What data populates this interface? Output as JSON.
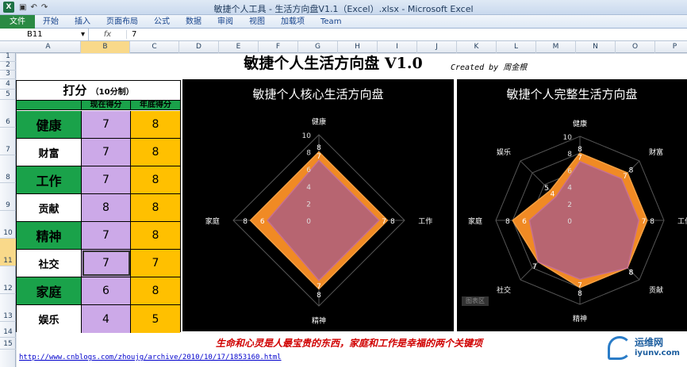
{
  "window": {
    "title": "敏捷个人工具 - 生活方向盘V1.1（Excel）.xlsx - Microsoft Excel",
    "app_icon": "X"
  },
  "ribbon": {
    "tabs": [
      "文件",
      "开始",
      "插入",
      "页面布局",
      "公式",
      "数据",
      "审阅",
      "视图",
      "加载项",
      "Team"
    ]
  },
  "formula_bar": {
    "cell": "B11",
    "fx": "fx",
    "value": "7"
  },
  "columns": [
    "A",
    "B",
    "C",
    "D",
    "E",
    "F",
    "G",
    "H",
    "I",
    "J",
    "K",
    "L",
    "M",
    "N",
    "O",
    "P"
  ],
  "rows": [
    "1",
    "2",
    "3",
    "4",
    "5",
    "6",
    "7",
    "8",
    "9",
    "10",
    "11",
    "12",
    "13",
    "14",
    "15"
  ],
  "sheet": {
    "title": "敏捷个人生活方向盘 V1.0",
    "credit": "Created by 周金根",
    "score_header": "打分",
    "score_header_note": "（10分制）",
    "col_now": "现在得分",
    "col_end": "年底得分",
    "slogan": "生命和心灵是人最宝贵的东西，家庭和工作是幸福的两个关键项",
    "link": "http://www.cnblogs.com/zhoujg/archive/2010/10/17/1853160.html",
    "items": [
      {
        "name": "健康",
        "now": "7",
        "end": "8",
        "style": "green"
      },
      {
        "name": "财富",
        "now": "7",
        "end": "8",
        "style": "white"
      },
      {
        "name": "工作",
        "now": "7",
        "end": "8",
        "style": "green"
      },
      {
        "name": "贡献",
        "now": "8",
        "end": "8",
        "style": "white"
      },
      {
        "name": "精神",
        "now": "7",
        "end": "8",
        "style": "green"
      },
      {
        "name": "社交",
        "now": "7",
        "end": "7",
        "style": "white"
      },
      {
        "name": "家庭",
        "now": "6",
        "end": "8",
        "style": "green"
      },
      {
        "name": "娱乐",
        "now": "4",
        "end": "5",
        "style": "white"
      }
    ]
  },
  "chart_tag": "图表区",
  "watermark": {
    "text1": "运维网",
    "text2": "iyunv.com"
  },
  "chart_data": [
    {
      "type": "radar",
      "title": "敏捷个人核心生活方向盘",
      "axes": [
        "健康",
        "工作",
        "精神",
        "家庭"
      ],
      "ylim": [
        0,
        10
      ],
      "ticks": [
        0,
        2,
        4,
        6,
        8,
        10
      ],
      "series": [
        {
          "values": [
            7,
            7,
            7,
            6
          ],
          "color": "#b0607a"
        },
        {
          "values": [
            8,
            8,
            8,
            8
          ],
          "color": "#f08a24"
        }
      ]
    },
    {
      "type": "radar",
      "title": "敏捷个人完整生活方向盘",
      "axes": [
        "健康",
        "财富",
        "工作",
        "贡献",
        "精神",
        "社交",
        "家庭",
        "娱乐"
      ],
      "ylim": [
        0,
        10
      ],
      "ticks": [
        0,
        2,
        4,
        6,
        8,
        10
      ],
      "series": [
        {
          "values": [
            7,
            7,
            7,
            8,
            7,
            7,
            6,
            4
          ],
          "color": "#b0607a"
        },
        {
          "values": [
            8,
            8,
            8,
            8,
            8,
            7,
            8,
            5
          ],
          "color": "#f08a24"
        }
      ]
    }
  ]
}
